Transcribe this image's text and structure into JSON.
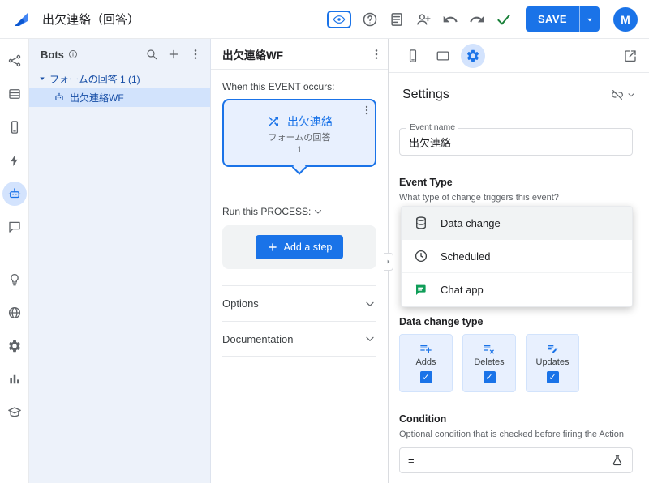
{
  "colors": {
    "accent": "#1a73e8",
    "accent_light": "#d3e3fd",
    "card_bg": "#e8f0fe",
    "panel_bg": "#edf2fa",
    "success": "#188038"
  },
  "topbar": {
    "title": "出欠連絡（回答）",
    "save_label": "SAVE",
    "avatar_initial": "M"
  },
  "left_rail": {
    "items": [
      "workflow",
      "data",
      "app",
      "actions",
      "automation",
      "chat",
      "intelligence",
      "deploy",
      "settings",
      "manage",
      "learn"
    ],
    "selected": "automation"
  },
  "bots_panel": {
    "title": "Bots",
    "group_label": "フォームの回答 1 (1)",
    "bot_label": "出欠連絡WF"
  },
  "middle_panel": {
    "title": "出欠連絡WF",
    "event_section_label": "When this EVENT occurs:",
    "event_card": {
      "title": "出欠連絡",
      "subtitle_line1": "フォームの回答",
      "subtitle_line2": "1"
    },
    "process_label": "Run this PROCESS:",
    "add_step_label": "Add a step",
    "options_label": "Options",
    "documentation_label": "Documentation"
  },
  "right_panel": {
    "title": "Settings",
    "event_name": {
      "label": "Event name",
      "value": "出欠連絡"
    },
    "event_type": {
      "label": "Event Type",
      "help": "What type of change triggers this event?",
      "options": [
        {
          "label": "Data change",
          "icon": "database-icon",
          "selected": true
        },
        {
          "label": "Scheduled",
          "icon": "clock-icon",
          "selected": false
        },
        {
          "label": "Chat app",
          "icon": "chat-app-icon",
          "selected": false
        }
      ]
    },
    "data_change_type": {
      "label": "Data change type",
      "options": [
        {
          "label": "Adds",
          "checked": true
        },
        {
          "label": "Deletes",
          "checked": true
        },
        {
          "label": "Updates",
          "checked": true
        }
      ]
    },
    "condition": {
      "label": "Condition",
      "help": "Optional condition that is checked before firing the Action",
      "value": "="
    }
  }
}
